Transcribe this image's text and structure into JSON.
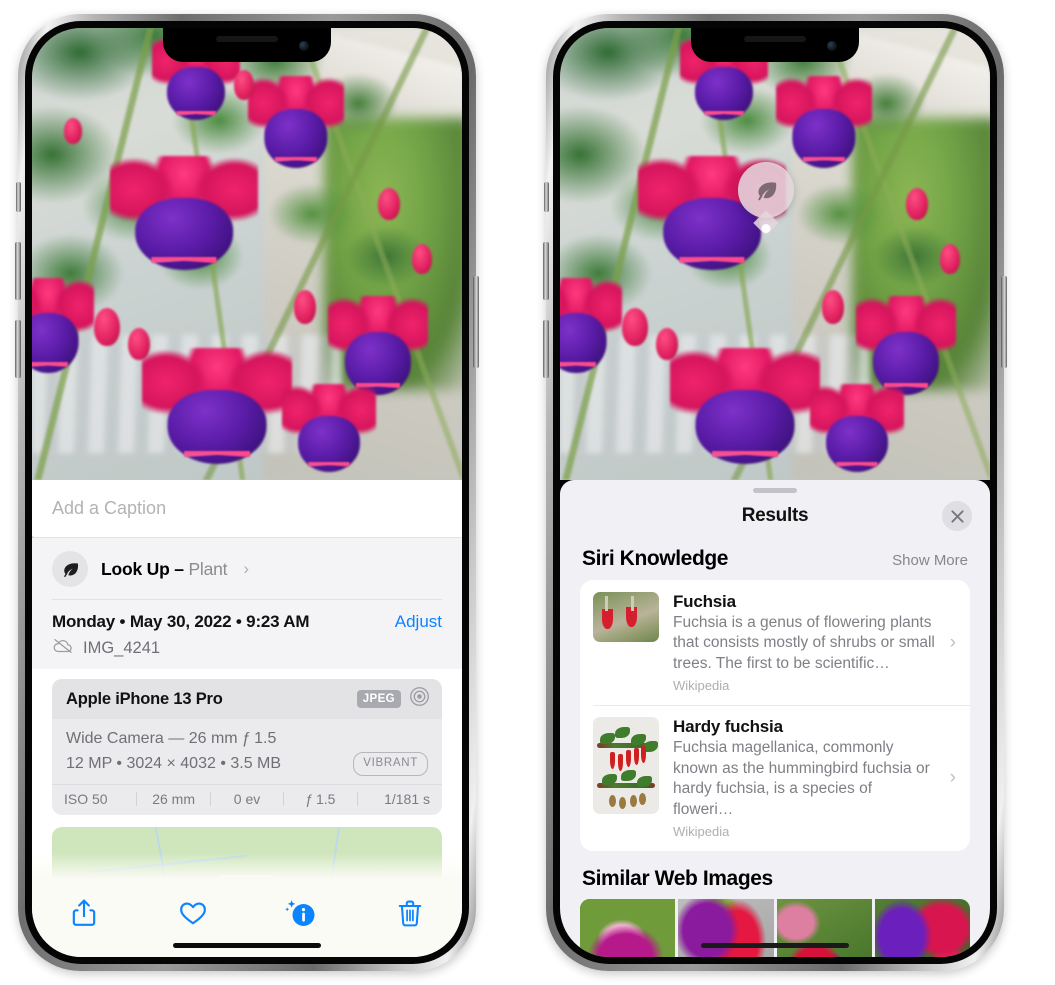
{
  "left_phone": {
    "photo": {
      "alt_name": "fuchsia-flowers-photo"
    },
    "caption_field": {
      "placeholder": "Add a Caption",
      "value": ""
    },
    "lookup_row": {
      "icon": "leaf-icon",
      "sparkle_icon": "sparkle-icon",
      "label": "Look Up – ",
      "subject": "Plant",
      "chevron": "›"
    },
    "metadata": {
      "date_line": "Monday • May 30, 2022 • 9:23 AM",
      "adjust_label": "Adjust",
      "cloud_icon": "cloud-slash-icon",
      "filename": "IMG_4241"
    },
    "camera_card": {
      "model": "Apple iPhone 13 Pro",
      "format_badge": "JPEG",
      "aperture_icon": "aperture-icon",
      "lens_line": "Wide Camera — 26 mm ƒ 1.5",
      "size_line": "12 MP • 3024 × 4032 • 3.5 MB",
      "style_badge": "VIBRANT",
      "exif": [
        "ISO 50",
        "26 mm",
        "0 ev",
        "ƒ 1.5",
        "1/181 s"
      ]
    },
    "map": {
      "name": "location-map-strip",
      "pin": "photo-thumbnail-pin"
    },
    "toolbar": [
      {
        "name": "share-button",
        "icon": "share-icon"
      },
      {
        "name": "favorite-button",
        "icon": "heart-icon"
      },
      {
        "name": "info-button",
        "icon": "info-sparkle-icon"
      },
      {
        "name": "delete-button",
        "icon": "trash-icon"
      }
    ],
    "accent_color": "#0b84ff"
  },
  "right_phone": {
    "visual_lookup_badge": {
      "icon": "leaf-icon"
    },
    "sheet": {
      "grabber": "sheet-grabber",
      "title": "Results",
      "close_icon": "close-icon"
    },
    "siri_knowledge": {
      "title": "Siri Knowledge",
      "show_more": "Show More",
      "items": [
        {
          "title": "Fuchsia",
          "description": "Fuchsia is a genus of flowering plants that consists mostly of shrubs or small trees. The first to be scientific…",
          "source": "Wikipedia",
          "thumb": "fuchsia-thumbnail"
        },
        {
          "title": "Hardy fuchsia",
          "description": "Fuchsia magellanica, commonly known as the hummingbird fuchsia or hardy fuchsia, is a species of floweri…",
          "source": "Wikipedia",
          "thumb": "hardy-fuchsia-thumbnail"
        }
      ]
    },
    "similar_web_images": {
      "title": "Similar Web Images",
      "images": [
        "web-image-1",
        "web-image-2",
        "web-image-3",
        "web-image-4"
      ]
    },
    "sheet_background": "#f1f1f5"
  }
}
